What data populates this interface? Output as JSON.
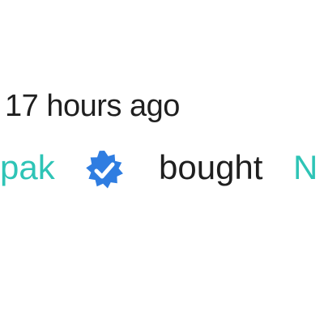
{
  "activity": {
    "timestamp": "17 hours ago",
    "user": "pak",
    "verified_icon": "verified-check-icon",
    "verb": "bought",
    "item": "N"
  },
  "colors": {
    "accent": "#2ec4b6",
    "badge": "#2f7de1",
    "text": "#1f1f1f"
  }
}
